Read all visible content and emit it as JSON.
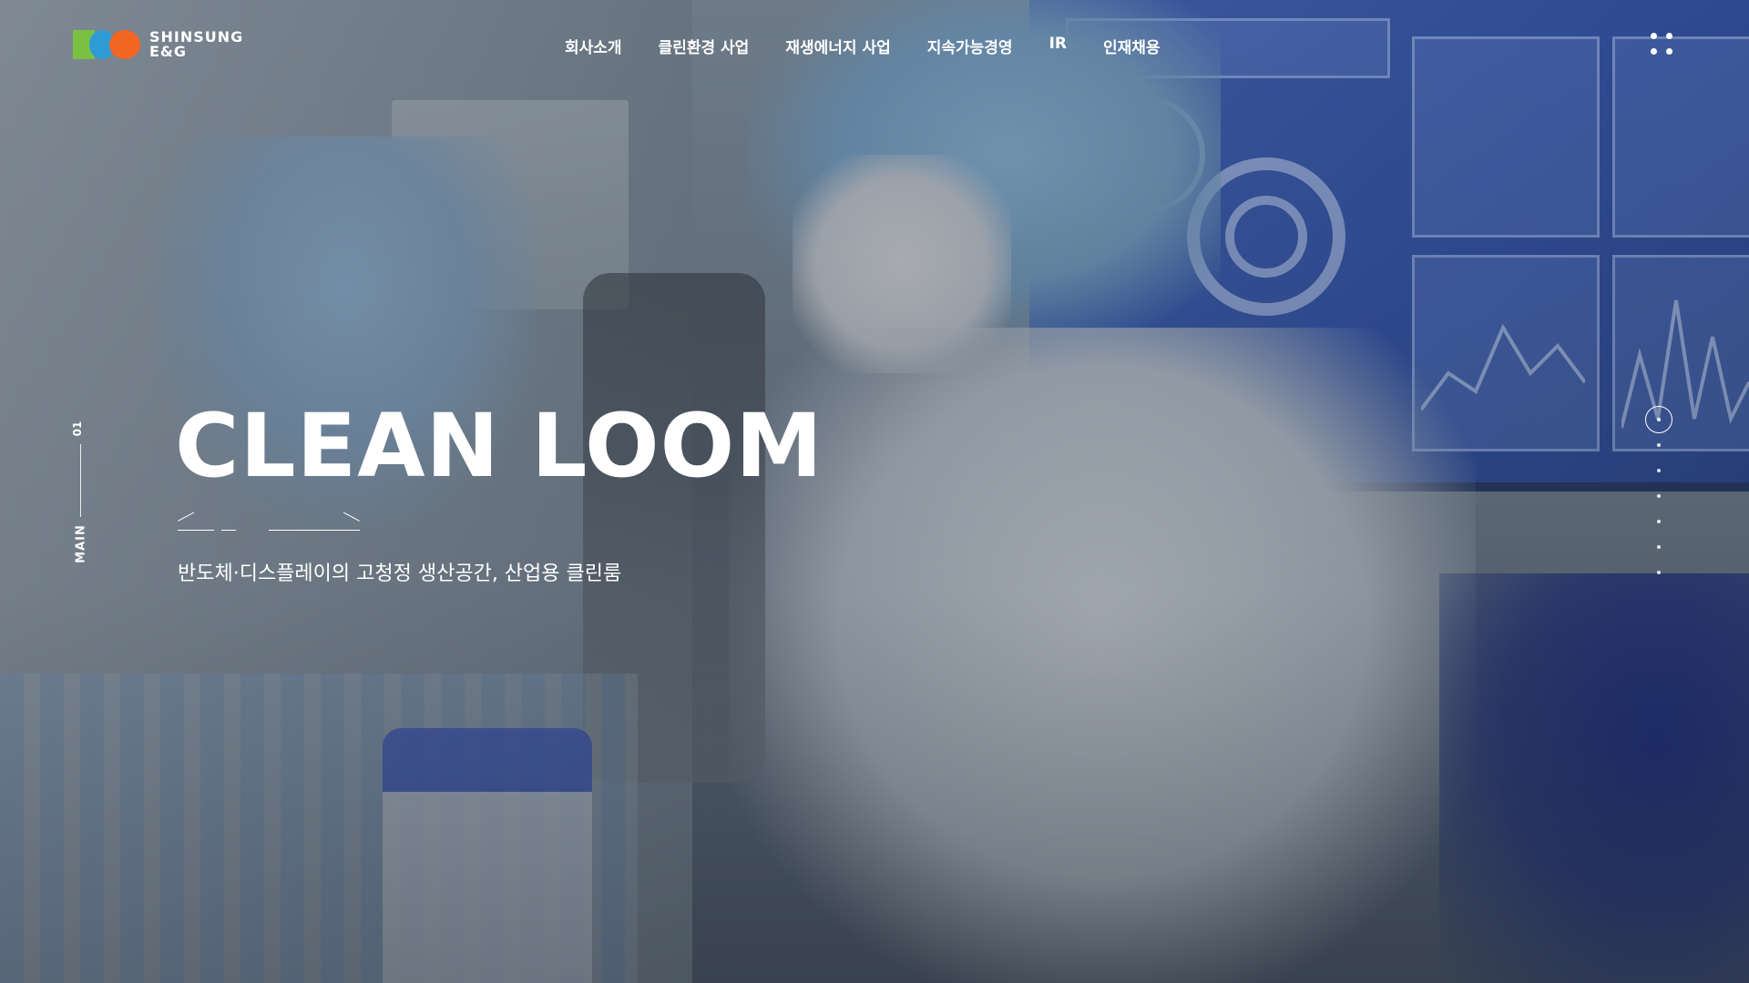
{
  "header": {
    "logo_text_line1": "SHINSUNG",
    "logo_text_line2": "E&G",
    "nav": [
      {
        "label": "회사소개"
      },
      {
        "label": "클린환경 사업"
      },
      {
        "label": "재생에너지 사업"
      },
      {
        "label": "지속가능경영"
      },
      {
        "label": "IR"
      },
      {
        "label": "인재채용"
      }
    ]
  },
  "side_indicator": {
    "number": "01",
    "label": "MAIN"
  },
  "hero": {
    "title": "CLEAN LOOM",
    "subtitle": "반도체·디스플레이의 고청정 생산공간, 산업용 클린룸"
  },
  "pager": {
    "total_slides": 7,
    "active_index": 0
  },
  "colors": {
    "logo_green": "#7ac143",
    "logo_blue": "#2e9bd6",
    "logo_orange": "#f26522",
    "text": "#ffffff"
  },
  "icons": {
    "menu": "grid-dots-icon"
  }
}
